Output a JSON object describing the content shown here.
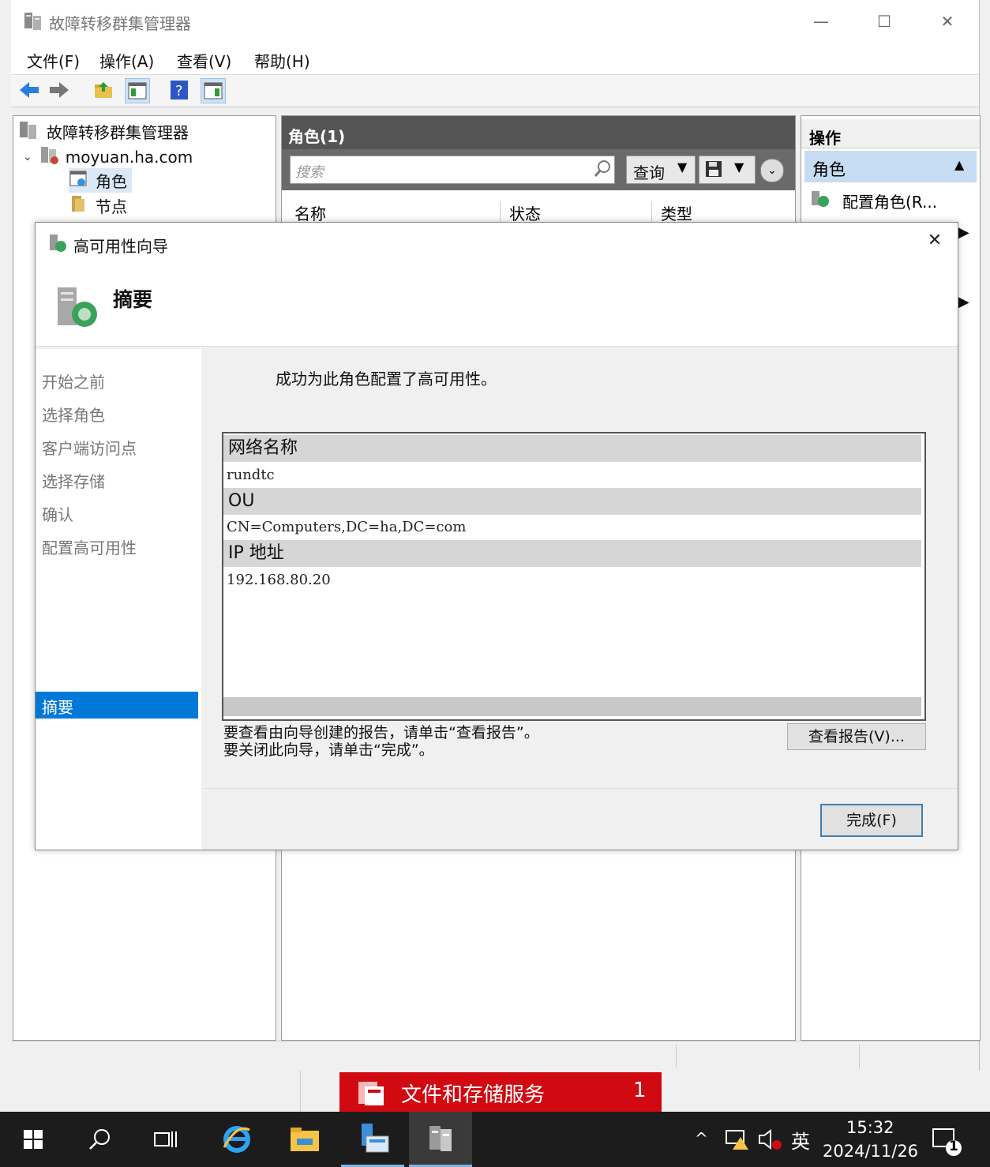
{
  "window": {
    "title": "故障转移群集管理器",
    "menu": [
      "文件(F)",
      "操作(A)",
      "查看(V)",
      "帮助(H)"
    ]
  },
  "tree": {
    "root": "故障转移群集管理器",
    "cluster": "moyuan.ha.com",
    "items": [
      "角色",
      "节点"
    ]
  },
  "roles_pane": {
    "header": "角色(1)",
    "search_placeholder": "搜索",
    "query_button": "查询",
    "columns": [
      "名称",
      "状态",
      "类型"
    ]
  },
  "actions_pane": {
    "header": "操作",
    "section": "角色",
    "items": [
      "配置角色(R..."
    ]
  },
  "dialog": {
    "title": "高可用性向导",
    "page_title": "摘要",
    "nav_items": [
      "开始之前",
      "选择角色",
      "客户端访问点",
      "选择存储",
      "确认",
      "配置高可用性",
      "摘要"
    ],
    "selected_nav": "摘要",
    "success_message": "成功为此角色配置了高可用性。",
    "summary": [
      {
        "label": "网络名称",
        "value": "rundtc"
      },
      {
        "label": "OU",
        "value": "CN=Computers,DC=ha,DC=com"
      },
      {
        "label": "IP 地址",
        "value": "192.168.80.20"
      }
    ],
    "report_hint_line1": "要查看由向导创建的报告，请单击“查看报告”。",
    "report_hint_line2": "要关闭此向导，请单击“完成”。",
    "view_report_button": "查看报告(V)...",
    "finish_button": "完成(F)"
  },
  "notification": {
    "label": "文件和存储服务",
    "count": "1"
  },
  "taskbar": {
    "ime": "英",
    "time": "15:32",
    "date": "2024/11/26",
    "notification_count": "1"
  }
}
